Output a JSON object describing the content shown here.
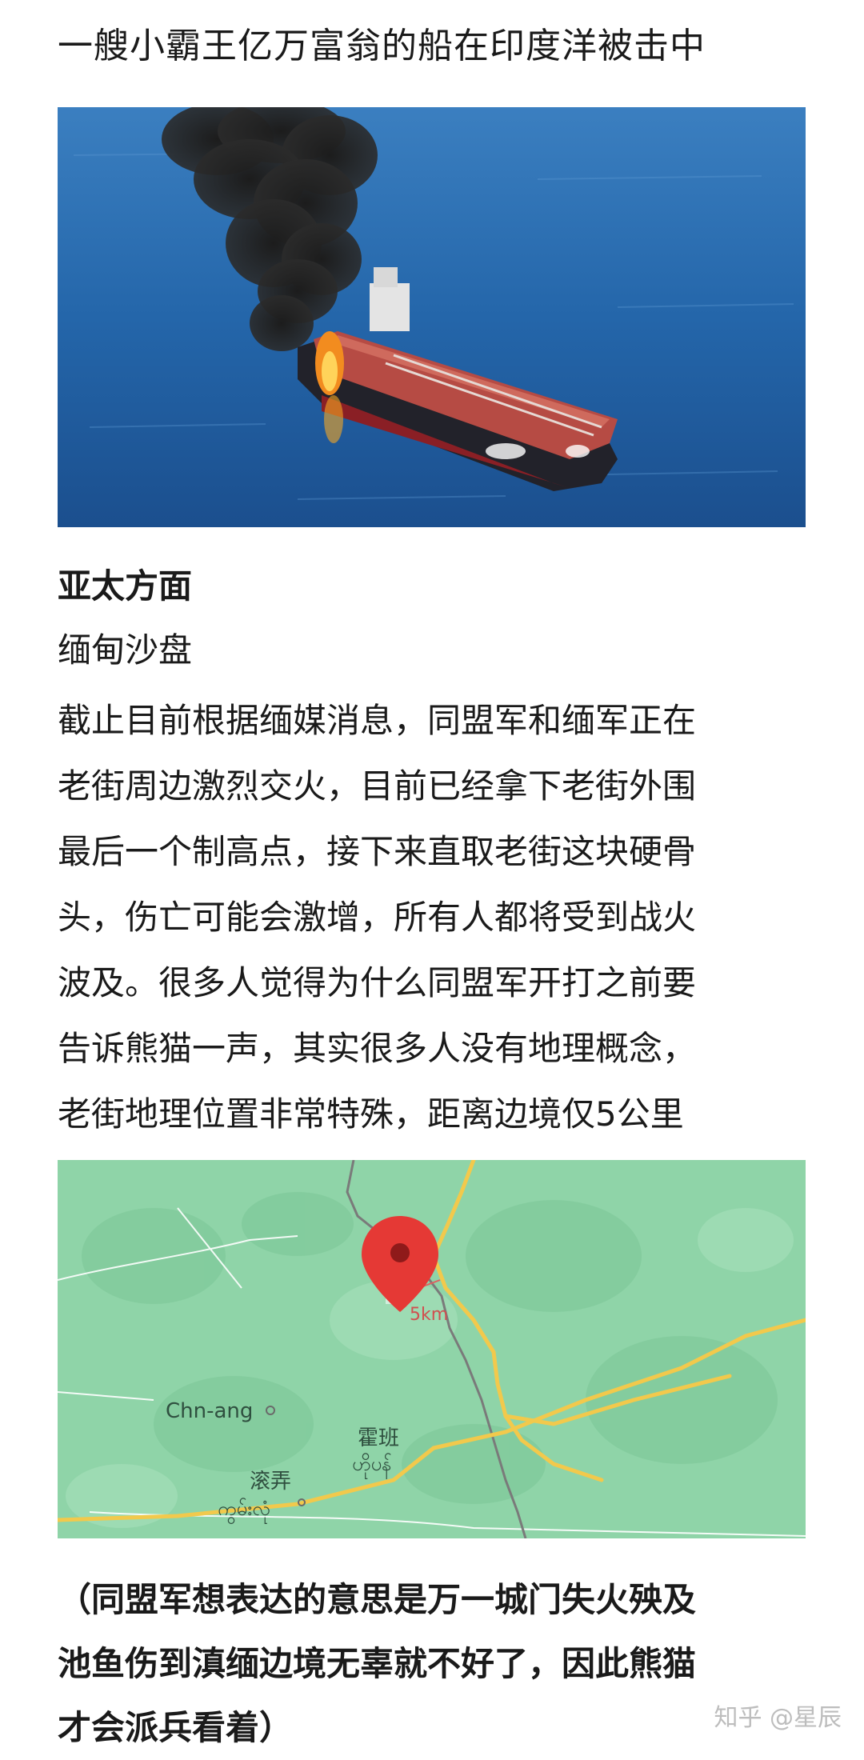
{
  "article": {
    "headline": "一艘小霸王亿万富翁的船在印度洋被击中",
    "section_title": "亚太方面",
    "sub_title": "缅甸沙盘",
    "paragraph_lines": [
      "截止目前根据缅媒消息，同盟军和缅军正在",
      "老街周边激烈交火，目前已经拿下老街外围",
      "最后一个制高点，接下来直取老街这块硬骨",
      "头，伤亡可能会激增，所有人都将受到战火",
      "波及。很多人觉得为什么同盟军开打之前要",
      "告诉熊猫一声，其实很多人没有地理概念，",
      "老街地理位置非常特殊，距离边境仅5公里"
    ],
    "caption_lines": [
      "（同盟军想表达的意思是万一城门失火殃及",
      "池鱼伤到滇缅边境无辜就不好了，因此熊猫",
      "才会派兵看着）"
    ]
  },
  "map": {
    "distance_annotation": "5km",
    "place1": "Chn-ang",
    "place2_cn": "霍班",
    "place2_mm": "ဟိုပန်",
    "place3_cn": "滚弄",
    "place3_mm": "ကွမ်းလုံ",
    "colors": {
      "land": "#8fd4a8",
      "road": "#f2c94c",
      "pin": "#e53935"
    }
  },
  "watermark": "知乎 @星辰",
  "icons": [
    "location-pin-icon"
  ]
}
